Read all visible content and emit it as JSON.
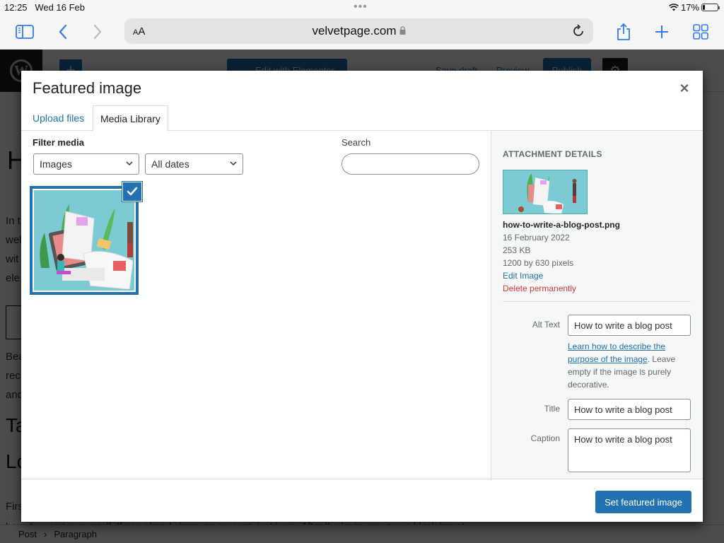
{
  "status_bar": {
    "time": "12:25",
    "date": "Wed 16 Feb",
    "battery_percent": "17%",
    "battery_level": 0.17
  },
  "browser": {
    "text_size_label": "AA",
    "url": "velvetpage.com",
    "icons": [
      "sidebar-icon",
      "back-icon",
      "forward-icon",
      "lock-icon",
      "reload-icon",
      "share-icon",
      "new-tab-icon",
      "tabs-icon"
    ]
  },
  "editor_background": {
    "edit_with_elementor": "Edit with Elementor",
    "save_draft": "Save draft",
    "preview": "Preview",
    "publish": "Publish",
    "heading_fragment": "H",
    "text_fragments": [
      "In t",
      "wel",
      "wit",
      "ele"
    ],
    "text_fragments_2": [
      "Bea",
      "rec",
      "and"
    ],
    "h2_fragments": [
      "Ta",
      "Lo"
    ],
    "para_fragment_start": "Firs",
    "para_line_2_a": "have to ",
    "para_link_register": "register",
    "para_line_2_b": " yourself. If you already have an account, just ",
    "para_link_login": "login",
    "para_line_2_c": ". After the login, you see a black bar at",
    "breadcrumb": [
      "Post",
      "Paragraph"
    ]
  },
  "modal": {
    "title": "Featured image",
    "close_label": "×",
    "tabs": [
      {
        "label": "Upload files",
        "active": false
      },
      {
        "label": "Media Library",
        "active": true
      }
    ],
    "filter": {
      "label": "Filter media",
      "type_selected": "Images",
      "date_selected": "All dates"
    },
    "search": {
      "label": "Search",
      "value": "",
      "placeholder": ""
    },
    "media_items": [
      {
        "filename": "how-to-write-a-blog-post.png",
        "selected": true
      }
    ],
    "attachment_details": {
      "heading": "ATTACHMENT DETAILS",
      "filename": "how-to-write-a-blog-post.png",
      "date": "16 February 2022",
      "size": "253 KB",
      "dimensions": "1200 by 630 pixels",
      "edit_link": "Edit Image",
      "delete_link": "Delete permanently",
      "alt_text_label": "Alt Text",
      "alt_text_value": "How to write a blog post",
      "alt_help_link": "Learn how to describe the purpose of the image",
      "alt_help_text": ". Leave empty if the image is purely decorative.",
      "title_label": "Title",
      "title_value": "How to write a blog post",
      "caption_label": "Caption",
      "caption_value": "How to write a blog post"
    },
    "primary_button": "Set featured image"
  },
  "colors": {
    "accent": "#2271b1",
    "danger": "#d63638",
    "ios_blue": "#2f7bf5"
  }
}
